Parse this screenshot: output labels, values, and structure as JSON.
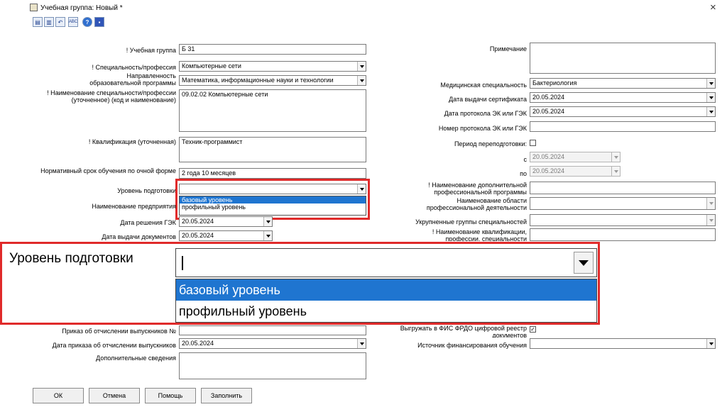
{
  "window": {
    "title": "Учебная группа: Новый *",
    "close": "×"
  },
  "toolbar": {
    "spell": "ABC",
    "help": "?"
  },
  "left": {
    "group_label": "! Учебная группа",
    "group_value": "Б 31",
    "spec_label": "! Специальность/профессия",
    "spec_value": "Компьютерные сети",
    "direction_label": "Направленность образовательной программы",
    "direction_value": "Математика, информационные науки и технологии",
    "name_spec_label": "! Наименование специальности/профессии (уточненное) (код и наименование)",
    "name_spec_value": "09.02.02 Компьютерные сети",
    "qual_label": "! Квалификация (уточненная)",
    "qual_value": "Техник-программист",
    "term_label": "Нормативный срок обучения по очной форме",
    "term_value": "2 года 10 месяцев",
    "level_label": "Уровень подготовки",
    "enterprise_label": "Наименование предприятия",
    "gek_date_label": "Дата решения ГЭК",
    "gek_date_value": "20.05.2024",
    "docs_date_label": "Дата выдачи документов",
    "docs_date_value": "20.05.2024",
    "order_label": "Приказ об отчислении выпускников №",
    "order_date_label": "Дата приказа об отчислении выпускников",
    "order_date_value": "20.05.2024",
    "extra_label": "Дополнительные сведения"
  },
  "dropdown": {
    "options": [
      "базовый уровень",
      "профильный уровень"
    ],
    "selected_index": 0
  },
  "right": {
    "note_label": "Примечание",
    "med_label": "Медицинская специальность",
    "med_value": "Бактериология",
    "cert_date_label": "Дата выдачи сертификата",
    "cert_date_value": "20.05.2024",
    "protocol_date_label": "Дата протокола ЭК или ГЭК",
    "protocol_date_value": "20.05.2024",
    "protocol_num_label": "Номер протокола ЭК или ГЭК",
    "retrain_label": "Период переподготовки:",
    "from_label": "с",
    "from_value": "20.05.2024",
    "to_label": "по",
    "to_value": "20.05.2024",
    "add_prog_label": "! Наименование дополнительной профессиональной программы",
    "area_label": "Наименование области профессиональной деятельности",
    "groups_label": "Укрупненные группы специальностей",
    "qual_name_label": "! Наименование квалификации, профессии, специальности",
    "registry_label": "Выгружать в ФИС ФРДО цифровой реестр документов",
    "finance_label": "Источник финансирования обучения"
  },
  "zoom": {
    "label": "Уровень подготовки",
    "options": [
      "базовый уровень",
      "профильный уровень"
    ]
  },
  "buttons": {
    "ok": "ОК",
    "cancel": "Отмена",
    "help": "Помощь",
    "fill": "Заполнить"
  },
  "colors": {
    "highlight": "#1f75d0",
    "callout": "#e02a2a"
  }
}
